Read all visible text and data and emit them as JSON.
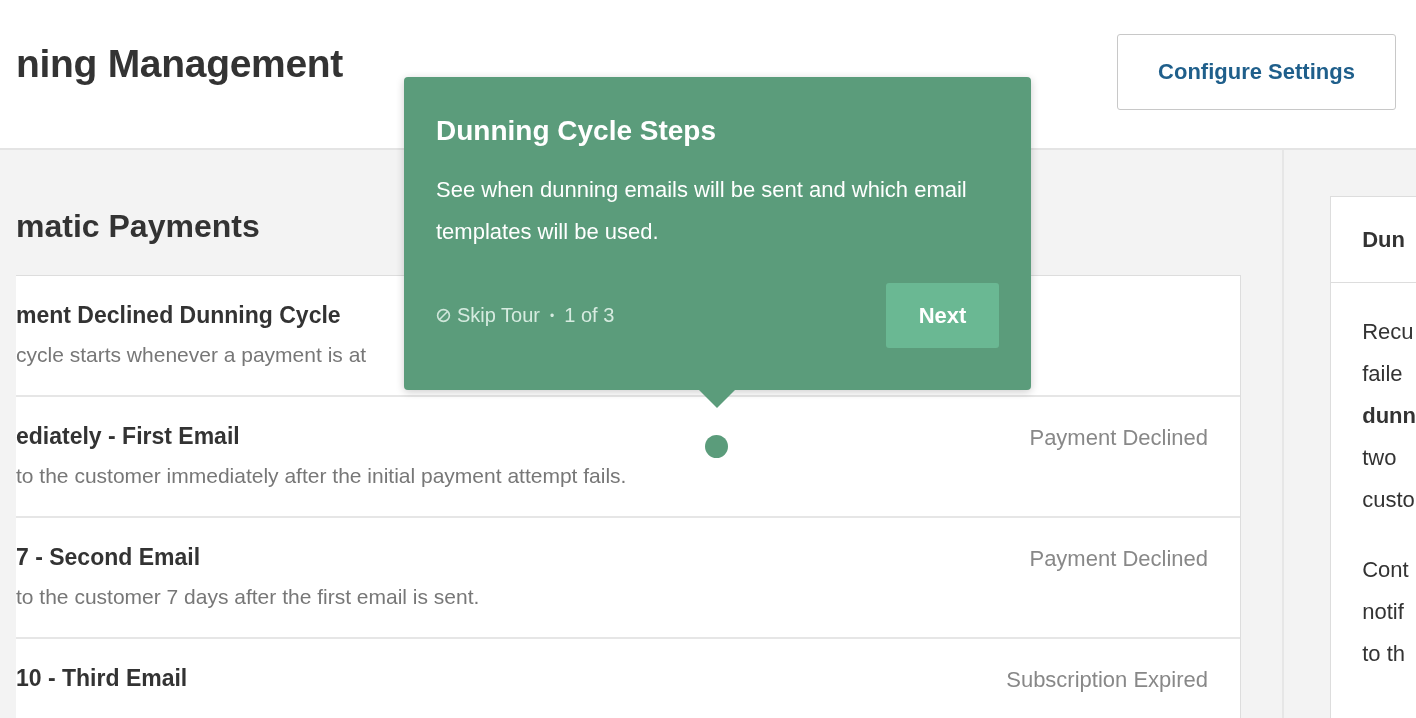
{
  "page_title": "ning Management",
  "configure_button": "Configure Settings",
  "section_title": "matic Payments",
  "steps": [
    {
      "title": "ment Declined Dunning Cycle",
      "description": "cycle starts whenever a payment is at"
    },
    {
      "title": "ediately - First Email",
      "description": "to the customer immediately after the initial payment attempt fails.",
      "tag": "Payment Declined"
    },
    {
      "title": "7 - Second Email",
      "description": "to the customer 7 days after the first email is sent.",
      "tag": "Payment Declined"
    },
    {
      "title": "10 - Third Email",
      "tag": "Subscription Expired"
    }
  ],
  "side_panel": {
    "title": "Dun",
    "paragraphs": [
      [
        {
          "text": "Recu",
          "bold": false
        },
        {
          "text": "faile",
          "bold": false
        },
        {
          "text": "dunn",
          "bold": true
        },
        {
          "text": "two",
          "bold": false
        },
        {
          "text": "custo",
          "bold": false
        }
      ],
      [
        {
          "text": "Cont",
          "bold": false
        },
        {
          "text": "notif",
          "bold": false
        },
        {
          "text": "to th",
          "bold": false
        }
      ]
    ]
  },
  "tour_tooltip": {
    "title": "Dunning Cycle Steps",
    "body": "See when dunning emails will be sent and which email templates will be used.",
    "skip": "Skip Tour",
    "separator": "•",
    "progress": "1 of 3",
    "next_button": "Next"
  }
}
